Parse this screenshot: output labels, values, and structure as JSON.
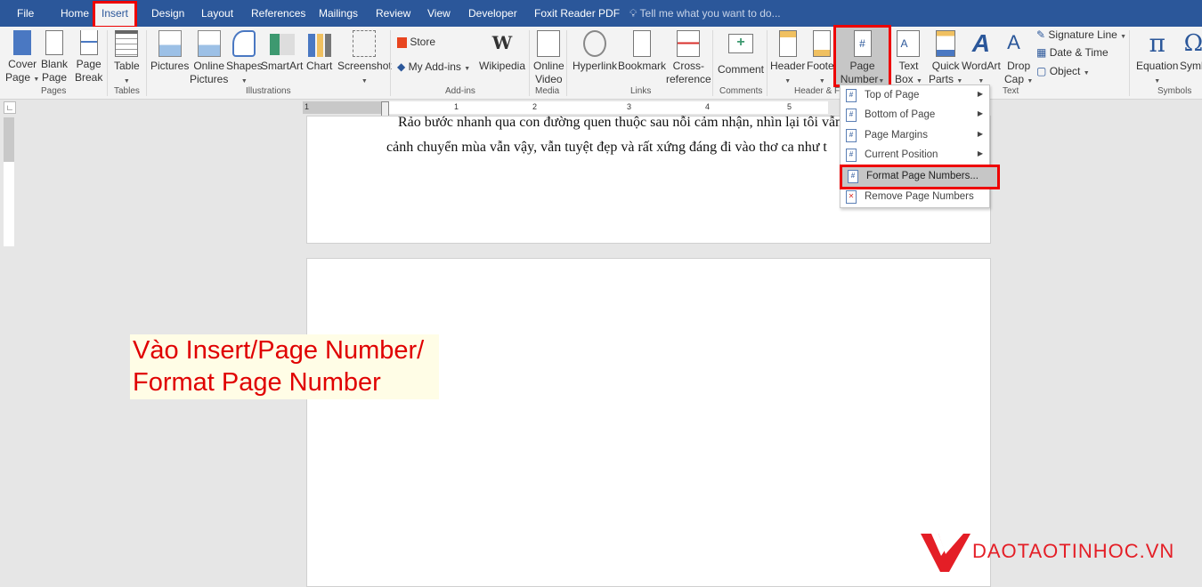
{
  "tabs": [
    "File",
    "Home",
    "Insert",
    "Design",
    "Layout",
    "References",
    "Mailings",
    "Review",
    "View",
    "Developer",
    "Foxit Reader PDF"
  ],
  "active_tab": "Insert",
  "tell_me": "Tell me what you want to do...",
  "ribbon": {
    "pages": {
      "label": "Pages",
      "cover": [
        "Cover",
        "Page"
      ],
      "blank": [
        "Blank",
        "Page"
      ],
      "break": [
        "Page",
        "Break"
      ]
    },
    "tables": {
      "label": "Tables",
      "table": "Table"
    },
    "illustrations": {
      "label": "Illustrations",
      "pictures": "Pictures",
      "online_pictures": [
        "Online",
        "Pictures"
      ],
      "shapes": "Shapes",
      "smartart": "SmartArt",
      "chart": "Chart",
      "screenshot": "Screenshot"
    },
    "addins": {
      "label": "Add-ins",
      "store": "Store",
      "my_addins": "My Add-ins",
      "wikipedia": "Wikipedia"
    },
    "media": {
      "label": "Media",
      "online_video": [
        "Online",
        "Video"
      ]
    },
    "links": {
      "label": "Links",
      "hyperlink": "Hyperlink",
      "bookmark": "Bookmark",
      "cross_reference": [
        "Cross-",
        "reference"
      ]
    },
    "comments": {
      "label": "Comments",
      "comment": "Comment"
    },
    "header_footer": {
      "label": "Header & F",
      "header": "Header",
      "footer": "Footer",
      "page_number": [
        "Page",
        "Number"
      ]
    },
    "text": {
      "label": "Text",
      "text_box": [
        "Text",
        "Box"
      ],
      "quick_parts": [
        "Quick",
        "Parts"
      ],
      "wordart": "WordArt",
      "drop_cap": [
        "Drop",
        "Cap"
      ],
      "signature_line": "Signature Line",
      "date_time": "Date & Time",
      "object": "Object"
    },
    "symbols": {
      "label": "Symbols",
      "equation": "Equation",
      "symbol": "Symb"
    }
  },
  "ruler": [
    "1",
    "1",
    "2",
    "3",
    "4",
    "5"
  ],
  "document": {
    "line1": "Rảo bước nhanh qua con đường quen thuộc sau nỗi cảm nhận, nhìn lại tôi vẫn",
    "line2": "cảnh chuyển mùa vẫn vậy, vẫn tuyệt đẹp và rất xứng đáng đi vào thơ ca như t"
  },
  "menu": [
    {
      "label": "Top of Page",
      "submenu": true
    },
    {
      "label": "Bottom of Page",
      "submenu": true
    },
    {
      "label": "Page Margins",
      "submenu": true
    },
    {
      "label": "Current Position",
      "submenu": true
    },
    {
      "label": "Format Page Numbers...",
      "submenu": false,
      "highlighted": true
    },
    {
      "label": "Remove Page Numbers",
      "submenu": false
    }
  ],
  "annotation": [
    "Vào Insert/Page Number/",
    "Format Page Number"
  ],
  "logo": "DAOTAOTINHOC.VN",
  "colors": {
    "brand": "#2b579a",
    "highlight": "#e00000"
  }
}
